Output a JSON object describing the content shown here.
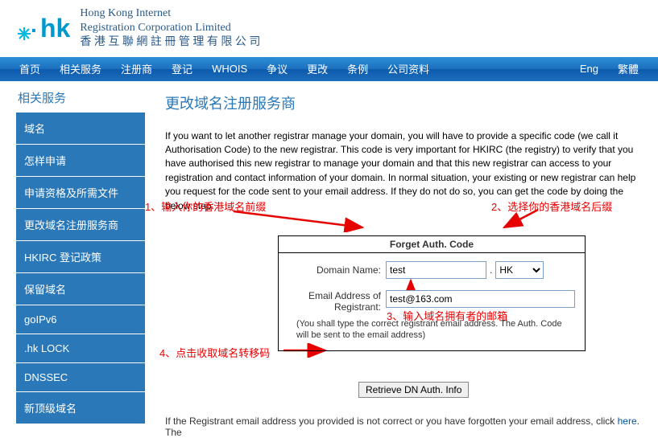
{
  "header": {
    "logo_text": "hk",
    "org_en": "Hong Kong Internet",
    "org_en2": "Registration Corporation Limited",
    "org_zh": "香 港 互 聯 網 註 冊 管 理 有 限 公 司"
  },
  "nav": {
    "items": [
      "首页",
      "相关服务",
      "注册商",
      "登记",
      "WHOIS",
      "争议",
      "更改",
      "条例",
      "公司资料"
    ],
    "right": [
      "Eng",
      "繁體"
    ]
  },
  "section_title": "相关服务",
  "sidebar": {
    "items": [
      "域名",
      "怎样申请",
      "申请资格及所需文件",
      "更改域名注册服务商",
      "HKIRC 登记政策",
      "保留域名",
      "goIPv6",
      ".hk LOCK",
      "DNSSEC",
      "新顶级域名"
    ]
  },
  "content": {
    "title": "更改域名注册服务商",
    "intro": "If you want to let another registrar manage your domain, you will have to provide a specific code (we call it Authorisation Code) to the new registrar. This code is very important for HKIRC (the registry) to verify that you have authorised this new registrar to manage your domain and that this new registrar can access to your registration and contact information of your domain. In normal situation, your existing or new registrar can help you request for the code sent to your email address. If they do not do so, you can get the code by doing the below step:"
  },
  "annotations": {
    "a1": "1、输入你的香港域名前缀",
    "a2": "2、选择你的香港域名后缀",
    "a3": "3、输入域名拥有者的邮箱",
    "a4": "4、点击收取域名转移码"
  },
  "form": {
    "title": "Forget Auth. Code",
    "domain_label": "Domain Name:",
    "domain_value": "test",
    "dot": ".",
    "tld_value": "HK",
    "email_label": "Email Address of Registrant:",
    "email_value": "test@163.com",
    "note": "(You shall type the correct registrant email address. The Auth. Code will be sent to the email address)",
    "button": "Retrieve DN Auth. Info"
  },
  "footer": {
    "text_before": "If the Registrant email address you provided is not correct or you have forgotten your email address, click ",
    "link": "here",
    "text_after": ". The"
  }
}
